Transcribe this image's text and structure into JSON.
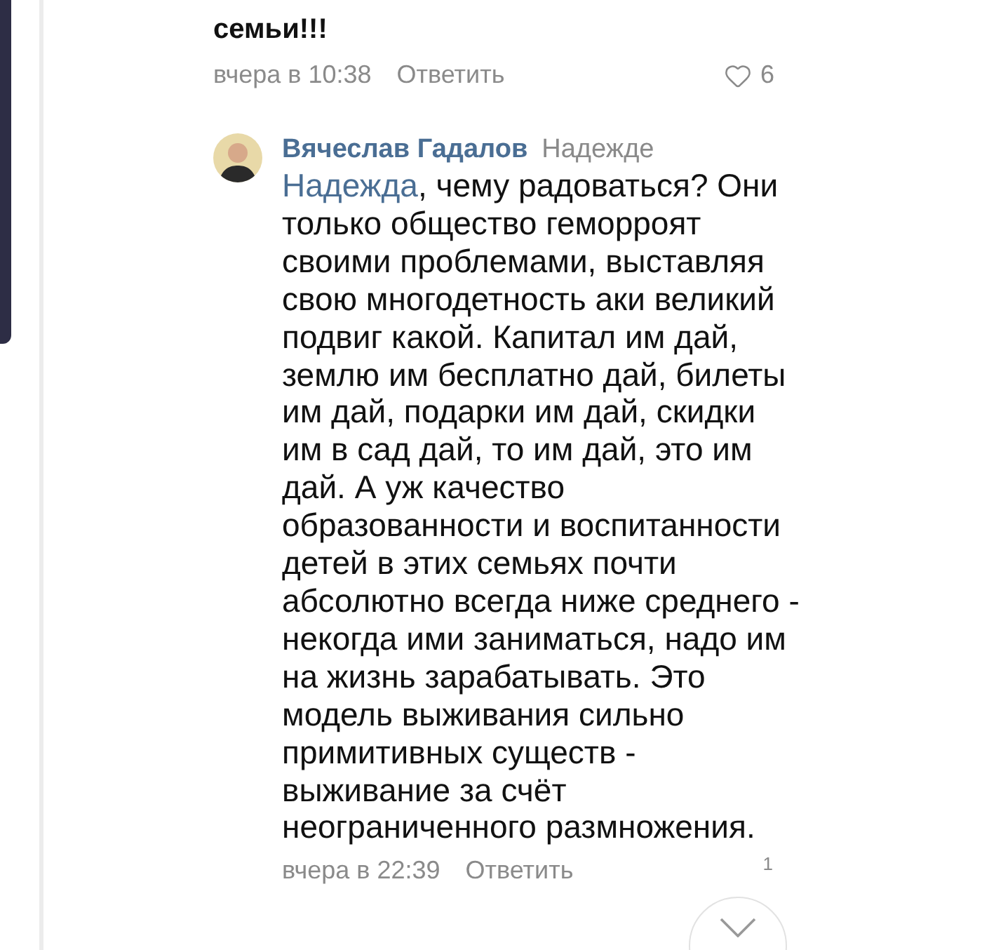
{
  "previous_comment": {
    "text_tail": "семьи!!!",
    "time": "вчера в 10:38",
    "reply_link": "Ответить",
    "likes": "6"
  },
  "comment": {
    "author": "Вячеслав Гадалов",
    "reply_to": "Надежде",
    "mention": "Надежда",
    "text": ", чему радоваться? Они только общество геморроят своими проблемами, выставляя свою многодетность аки великий подвиг какой. Капитал им дай, землю им бесплатно дай, билеты им дай, подарки им дай, скидки им в сад дай, то им дай, это им дай. А уж качество образованности и воспитанности детей в этих семьях почти абсолютно всегда ниже среднего - некогда ими заниматься, надо им на жизнь зарабатывать. Это модель выживания сильно примитивных существ - выживание за счёт неограниченного размножения.",
    "time": "вчера в 22:39",
    "reply_link": "Ответить",
    "likes": "1"
  }
}
